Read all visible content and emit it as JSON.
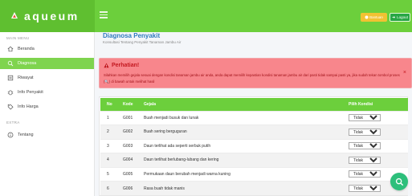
{
  "app": {
    "name": "aqueum",
    "buttons": {
      "help": "Bantuan",
      "logout": "Logout"
    }
  },
  "sidebar": {
    "headers": [
      "MAIN MENU",
      "EXTRA"
    ],
    "items": [
      {
        "label": "Beranda",
        "icon": "home-icon"
      },
      {
        "label": "Diagnosa",
        "icon": "search-icon",
        "active": true
      },
      {
        "label": "Riwayat",
        "icon": "history-icon"
      },
      {
        "label": "Info Penyakit",
        "icon": "bug-icon"
      },
      {
        "label": "Info Harga",
        "icon": "tag-icon"
      },
      {
        "label": "Tentang",
        "icon": "info-icon"
      }
    ]
  },
  "page": {
    "title": "Diagnosa Penyakit",
    "subtitle": "Konsultasi Tentang Penyakit Tanaman Jambu Air"
  },
  "alert": {
    "title": "Perhatian!",
    "text": "Silahkan memilih gejala sesuai dengan kondisi tanaman jambu air anda, anda dapat memilih kepastian kondisi tanaman jambu air dari pasti tidak sampai pasti ya, jika sudah tekan tombol proses (🔍) di bawah untuk melihat hasil",
    "close": "×"
  },
  "table": {
    "headers": {
      "no": "No",
      "kode": "Kode",
      "gejala": "Gejala",
      "kondisi": "Pilih Kondisi"
    },
    "rows": [
      {
        "no": "1",
        "kode": "G001",
        "gejala": "Buah menjadi busuk dan lunak",
        "kondisi": "Tidak"
      },
      {
        "no": "2",
        "kode": "G002",
        "gejala": "Buah sering berguguran",
        "kondisi": "Tidak"
      },
      {
        "no": "3",
        "kode": "G003",
        "gejala": "Daun terlihat ada seperti serbuk putih",
        "kondisi": "Tidak"
      },
      {
        "no": "4",
        "kode": "G004",
        "gejala": "Daun terlihat berlubang-lubang dan kering",
        "kondisi": "Tidak"
      },
      {
        "no": "5",
        "kode": "G005",
        "gejala": "Permukaan daun berubah menjadi warna kuning",
        "kondisi": "Tidak"
      },
      {
        "no": "6",
        "kode": "G006",
        "gejala": "Rasa buah tidak manis",
        "kondisi": "Tidak"
      }
    ]
  },
  "colors": {
    "accent": "#6ccf3c",
    "alert_bg": "#f8868c",
    "title": "#2e7bbf",
    "fab": "#2dbf7b"
  }
}
